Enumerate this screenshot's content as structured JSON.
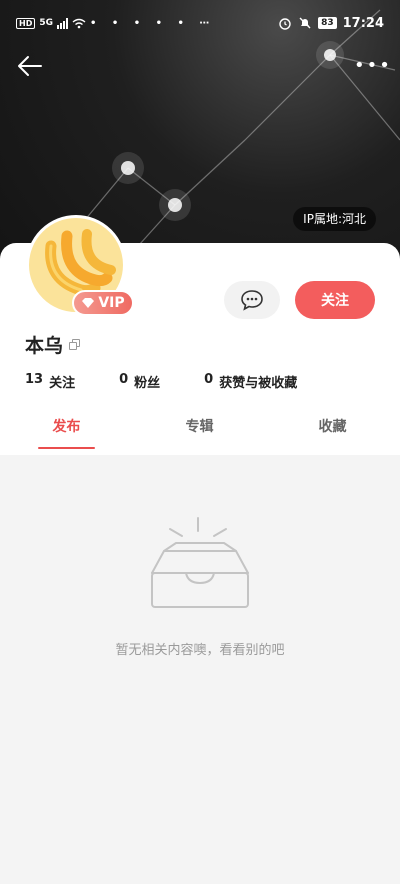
{
  "statusbar": {
    "left": [
      "HD",
      "5G"
    ],
    "notif_dots": "• • • • • ⋯",
    "battery": "83",
    "time": "17:24"
  },
  "profile": {
    "ip_location": "IP属地:河北",
    "vip_label": "VIP",
    "name": "本乌",
    "follow_label": "关注"
  },
  "stats": [
    {
      "num": "13",
      "label": "关注"
    },
    {
      "num": "0",
      "label": "粉丝"
    },
    {
      "num": "0",
      "label": "获赞与被收藏"
    }
  ],
  "tabs": [
    {
      "label": "发布",
      "active": true
    },
    {
      "label": "专辑",
      "active": false
    },
    {
      "label": "收藏",
      "active": false
    }
  ],
  "empty": {
    "message": "暂无相关内容噢，看看别的吧"
  },
  "colors": {
    "accent": "#f35d5d",
    "tab_active": "#ea4d4d"
  }
}
